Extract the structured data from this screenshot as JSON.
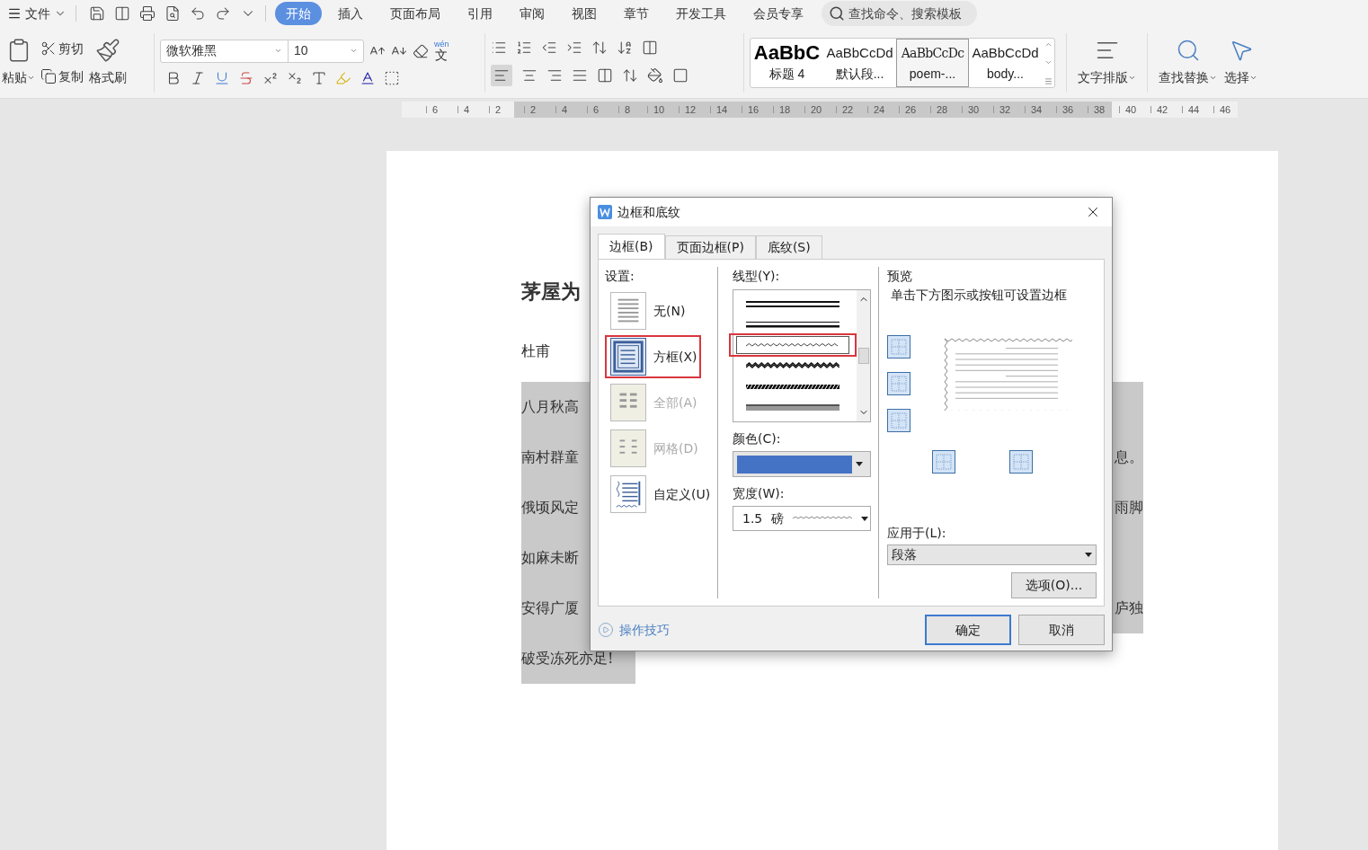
{
  "menu_bar": {
    "file_menu": "文件",
    "tabs": [
      {
        "label": "开始",
        "selected": true
      },
      {
        "label": "插入",
        "selected": false
      },
      {
        "label": "页面布局",
        "selected": false
      },
      {
        "label": "引用",
        "selected": false
      },
      {
        "label": "审阅",
        "selected": false
      },
      {
        "label": "视图",
        "selected": false
      },
      {
        "label": "章节",
        "selected": false
      },
      {
        "label": "开发工具",
        "selected": false
      },
      {
        "label": "会员专享",
        "selected": false
      }
    ],
    "search": {
      "placeholder": "查找命令、搜索模板"
    }
  },
  "ribbon": {
    "paste": "粘贴",
    "cut": "剪切",
    "copy": "复制",
    "format_painter": "格式刷",
    "font_name": "微软雅黑",
    "font_size": "10",
    "phonetic": {
      "pinyin": "wén",
      "char": "文"
    },
    "styles": [
      {
        "preview": "AaBbC",
        "label": "标题 4",
        "selected": false,
        "kind": "heading"
      },
      {
        "preview": "AaBbCcDd",
        "label": "默认段...",
        "selected": false,
        "kind": "normal"
      },
      {
        "preview": "AaBbCcDc",
        "label": "poem-...",
        "selected": true,
        "kind": "serif"
      },
      {
        "preview": "AaBbCcDd",
        "label": "body...",
        "selected": false,
        "kind": "normal"
      }
    ],
    "text_layout": "文字排版",
    "find_replace": "查找替换",
    "select": "选择"
  },
  "ruler": {
    "left_ticks": [
      "6",
      "4",
      "2"
    ],
    "right_ticks": [
      "2",
      "4",
      "6",
      "8",
      "10",
      "12",
      "14",
      "16",
      "18",
      "20",
      "22",
      "24",
      "26",
      "28",
      "30",
      "32",
      "34",
      "36",
      "38",
      "40",
      "42",
      "44",
      "46"
    ]
  },
  "document": {
    "title": "茅屋为",
    "author": "杜甫",
    "lines": [
      {
        "left": "八月秋高"
      },
      {
        "left": "南村群童",
        "right": "息。"
      },
      {
        "left": "俄顷风定",
        "right": "雨脚"
      },
      {
        "left": "如麻未断"
      },
      {
        "left": "安得广厦",
        "right": "庐独"
      },
      {
        "left": "破受冻死亦足!"
      }
    ]
  },
  "dialog": {
    "title": "边框和底纹",
    "tabs": [
      {
        "label": "边框(B)",
        "selected": true
      },
      {
        "label": "页面边框(P)",
        "selected": false
      },
      {
        "label": "底纹(S)",
        "selected": false
      }
    ],
    "settings_label": "设置:",
    "settings": [
      {
        "label": "无(N)",
        "kind": "none",
        "selected": false,
        "disabled": false,
        "highlighted": false
      },
      {
        "label": "方框(X)",
        "kind": "box",
        "selected": true,
        "disabled": false,
        "highlighted": true
      },
      {
        "label": "全部(A)",
        "kind": "all",
        "selected": false,
        "disabled": true,
        "highlighted": false
      },
      {
        "label": "网格(D)",
        "kind": "grid",
        "selected": false,
        "disabled": true,
        "highlighted": false
      },
      {
        "label": "自定义(U)",
        "kind": "custom",
        "selected": false,
        "disabled": false,
        "highlighted": false
      }
    ],
    "line_style_label": "线型(Y):",
    "line_styles": [
      {
        "kind": "double",
        "selected": false,
        "highlighted": false
      },
      {
        "kind": "thin-thick",
        "selected": false,
        "highlighted": false
      },
      {
        "kind": "wavy",
        "selected": true,
        "highlighted": true
      },
      {
        "kind": "double-wavy",
        "selected": false,
        "highlighted": false
      },
      {
        "kind": "dash-dot",
        "selected": false,
        "highlighted": false
      },
      {
        "kind": "thick-gray",
        "selected": false,
        "highlighted": false
      }
    ],
    "color_label": "颜色(C):",
    "color": "#4472c4",
    "width_label": "宽度(W):",
    "width_value": "1.5",
    "width_unit": "磅",
    "preview_label": "预览",
    "preview_hint": "单击下方图示或按钮可设置边框",
    "apply_label": "应用于(L):",
    "apply_value": "段落",
    "options_button": "选项(O)...",
    "tips_link": "操作技巧",
    "ok_button": "确定",
    "cancel_button": "取消"
  }
}
